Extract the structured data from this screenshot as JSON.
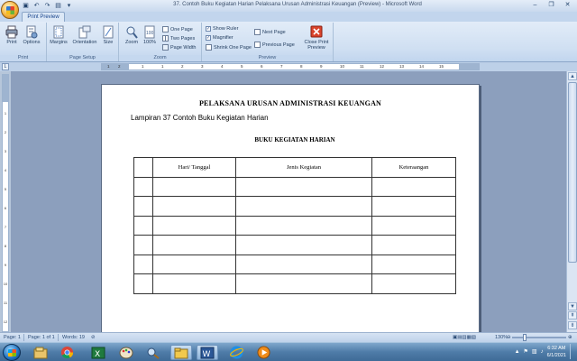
{
  "window": {
    "title": "37. Contoh Buku Kegiatan Harian Pelaksana Urusan Administrasi Keuangan (Preview) - Microsoft Word",
    "controls": [
      "–",
      "❐",
      "✕"
    ]
  },
  "ribbon": {
    "active_tab": "Print Preview",
    "groups": {
      "print": {
        "label": "Print",
        "print_button": "Print",
        "options_button": "Options"
      },
      "page_setup": {
        "label": "Page Setup",
        "margins": "Margins",
        "orientation": "Orientation",
        "size": "Size"
      },
      "zoom": {
        "label": "Zoom",
        "zoom": "Zoom",
        "zoom_100": "100%",
        "one_page": "One Page",
        "two_pages": "Two Pages",
        "page_width": "Page Width"
      },
      "preview": {
        "label": "Preview",
        "show_ruler": "Show Ruler",
        "magnifier": "Magnifier",
        "shrink_one_page": "Shrink One Page",
        "next_page": "Next Page",
        "previous_page": "Previous Page",
        "close_line1": "Close Print",
        "close_line2": "Preview"
      }
    }
  },
  "ruler": {
    "ticks": [
      "1",
      "2",
      "1",
      "1",
      "2",
      "3",
      "4",
      "5",
      "6",
      "7",
      "8",
      "9",
      "10",
      "11",
      "12",
      "13",
      "14",
      "15"
    ],
    "vticks": [
      "1",
      "2",
      "3",
      "4",
      "5",
      "6",
      "7",
      "8",
      "9",
      "10",
      "11",
      "12"
    ]
  },
  "document": {
    "heading": "PELAKSANA URUSAN ADMINISTRASI  KEUANGAN",
    "subheading": "Lampiran 37 Contoh Buku  Kegiatan  Harian",
    "table_title": "BUKU KEGIATAN HARIAN",
    "table": {
      "headers": [
        "",
        "Hari/ Tanggal",
        "Jenis Kegiatan",
        "Keteraangan"
      ],
      "empty_rows": 6
    }
  },
  "statusbar": {
    "page": "Page: 1",
    "page_of": "Page: 1 of 1",
    "words": "Words: 19",
    "zoom": "130%"
  },
  "taskbar": {
    "apps": [
      "explorer",
      "excel",
      "chrome",
      "paint",
      "folder",
      "word",
      "internet-explorer",
      "media-player"
    ],
    "time": "6:32 AM",
    "date": "6/1/2021"
  },
  "colors": {
    "ribbon_bg": "#dce8f6",
    "workspace_bg": "#8c9fbd",
    "taskbar_bg": "#4f7ca8"
  }
}
